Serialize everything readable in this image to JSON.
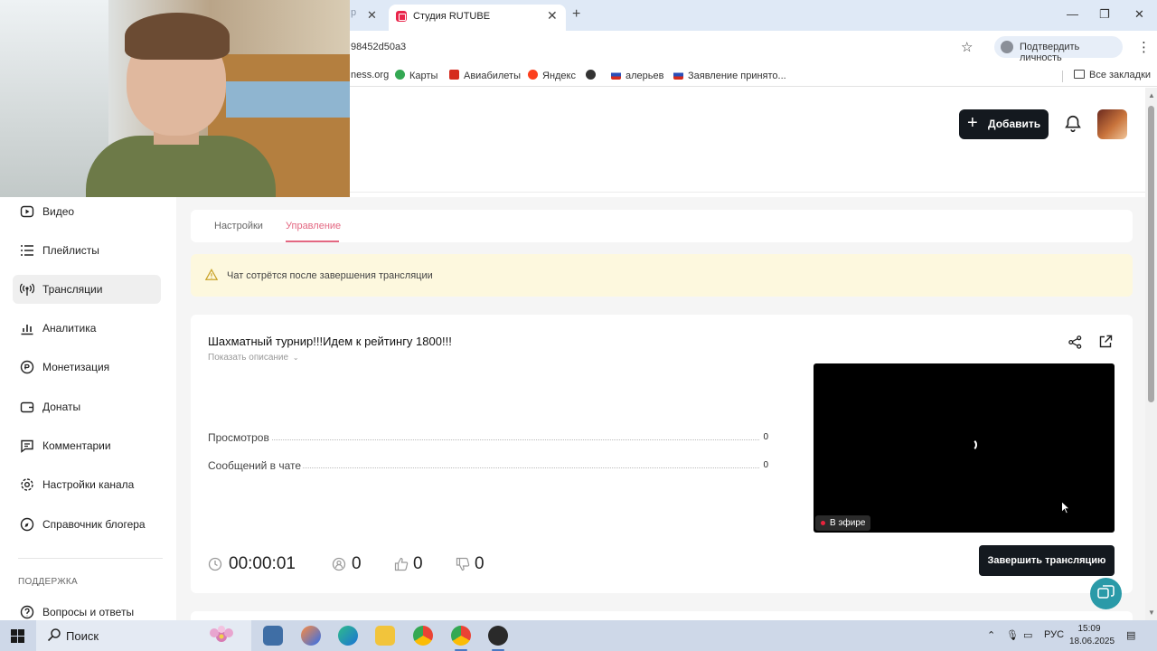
{
  "browser": {
    "prev_tab_hint": "р",
    "active_tab_title": "Студия RUTUBE",
    "url_fragment": "98452d50a3",
    "verify_label": "Подтвердить личность",
    "bookmarks": [
      "ness.org",
      "Карты",
      "Авиабилеты",
      "Яндекс",
      "",
      "алерьев",
      "Заявление принято...",
      "Все закладки"
    ]
  },
  "header": {
    "add_label": "Добавить"
  },
  "sidebar": {
    "items": [
      {
        "label": "Видео",
        "icon": "video-icon"
      },
      {
        "label": "Плейлисты",
        "icon": "list-icon"
      },
      {
        "label": "Трансляции",
        "icon": "broadcast-icon",
        "active": true
      },
      {
        "label": "Аналитика",
        "icon": "analytics-icon"
      },
      {
        "label": "Монетизация",
        "icon": "money-icon"
      },
      {
        "label": "Донаты",
        "icon": "wallet-icon"
      },
      {
        "label": "Комментарии",
        "icon": "comment-icon"
      },
      {
        "label": "Настройки канала",
        "icon": "gear-icon"
      },
      {
        "label": "Справочник блогера",
        "icon": "book-icon"
      }
    ],
    "section_support": "ПОДДЕРЖКА",
    "support_items": [
      {
        "label": "Вопросы и ответы",
        "icon": "help-icon"
      }
    ]
  },
  "tabs": {
    "settings": "Настройки",
    "manage": "Управление"
  },
  "warning": {
    "text": "Чат сотрётся после завершения трансляции"
  },
  "stream": {
    "title": "Шахматный турнир!!!Идем к рейтингу 1800!!!",
    "show_description": "Показать описание",
    "stats": [
      {
        "label": "Просмотров",
        "value": "0"
      },
      {
        "label": "Сообщений в чате",
        "value": "0"
      }
    ],
    "live_label": "В эфире",
    "duration": "00:00:01",
    "viewers": "0",
    "likes": "0",
    "dislikes": "0",
    "end_button": "Завершить трансляцию"
  },
  "taskbar": {
    "search_label": "Поиск",
    "language": "РУС",
    "time": "15:09",
    "date": "18.06.2025"
  },
  "colors": {
    "accent_pink": "#e36781",
    "dark_button": "#14191f",
    "warning_bg": "#fdf8de",
    "live_red": "#e8233d"
  }
}
